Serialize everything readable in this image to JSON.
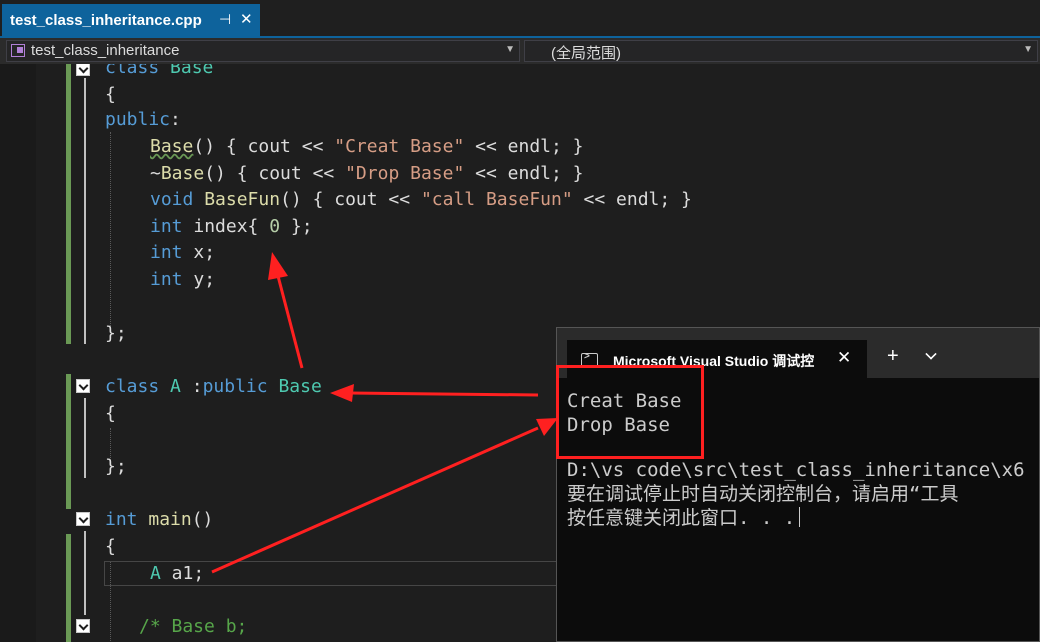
{
  "tab": {
    "title": "test_class_inheritance.cpp",
    "pin": "⊣",
    "close": "✕"
  },
  "nav": {
    "class_dropdown": "test_class_inheritance",
    "scope_dropdown": "(全局范围)",
    "caret": "▼"
  },
  "code": {
    "l1": {
      "kw": "class",
      "name": "Base"
    },
    "l2": "{",
    "l3": {
      "kw": "public",
      "colon": ":"
    },
    "l4": {
      "name": "Base",
      "rest_a": "() { cout << ",
      "str": "\"Creat Base\"",
      "rest_b": " << endl; }"
    },
    "l5": {
      "tilde": "~",
      "name": "Base",
      "rest_a": "() { cout << ",
      "str": "\"Drop Base\"",
      "rest_b": " << endl; }"
    },
    "l6": {
      "kw": "void",
      "fn": "BaseFun",
      "rest_a": "() { cout << ",
      "str": "\"call BaseFun\"",
      "rest_b": " << endl; }"
    },
    "l7": {
      "kw": "int",
      "rest_a": " index{ ",
      "num": "0",
      "rest_b": " };"
    },
    "l8": {
      "kw": "int",
      "rest": " x;"
    },
    "l9": {
      "kw": "int",
      "rest": " y;"
    },
    "l10": "};",
    "l11": {
      "kw": "class",
      "name": "A",
      "mid": " :",
      "kw2": "public",
      "base": "Base"
    },
    "l12": "{",
    "l13": "};",
    "l14": {
      "kw": "int",
      "fn": "main",
      "rest": "()"
    },
    "l15": "{",
    "l16": {
      "ty": "A",
      "rest": " a1;"
    },
    "l17": {
      "comment": "/* Base b;"
    }
  },
  "console": {
    "title": "Microsoft Visual Studio 调试控",
    "close": "✕",
    "plus": "+",
    "output": [
      "Creat Base",
      "Drop Base"
    ],
    "path_line": "D:\\vs code\\src\\test_class_inheritance\\x6",
    "hint_line": "要在调试停止时自动关闭控制台，请启用“工具",
    "press_line": "按任意键关闭此窗口. . ."
  },
  "colors": {
    "keyword": "#569cd6",
    "type": "#4ec9b0",
    "string": "#d69d85",
    "annotation": "#ff2020",
    "accent": "#0e639c"
  },
  "icons": [
    "pin-icon",
    "close-icon",
    "class-icon",
    "dropdown-icon",
    "fold-toggle-icon",
    "terminal-icon",
    "plus-icon",
    "chevron-down-icon"
  ]
}
